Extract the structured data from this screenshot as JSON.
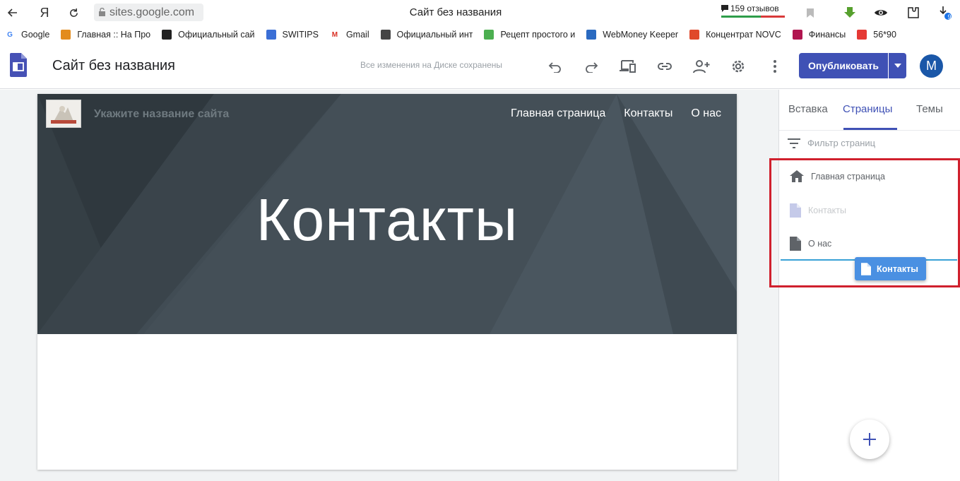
{
  "browser": {
    "url": "sites.google.com",
    "tab_title": "Сайт без названия",
    "reviews": "159 отзывов",
    "badge_count": "9"
  },
  "bookmarks": [
    {
      "label": "Google",
      "icon": "google-icon",
      "color": "#4285f4"
    },
    {
      "label": "Главная :: На Про",
      "icon": "bookmark-icon",
      "color": "#e38c1d"
    },
    {
      "label": "Официальный сай",
      "icon": "bookmark-icon",
      "color": "#222222"
    },
    {
      "label": "SWITIPS",
      "icon": "bookmark-icon",
      "color": "#3b6fd6"
    },
    {
      "label": "Gmail",
      "icon": "gmail-icon",
      "color": "#d93025"
    },
    {
      "label": "Официальный инт",
      "icon": "bookmark-icon",
      "color": "#444444"
    },
    {
      "label": "Рецепт простого и",
      "icon": "bookmark-icon",
      "color": "#4caf50"
    },
    {
      "label": "WebMoney Keeper",
      "icon": "bookmark-icon",
      "color": "#2a6ac0"
    },
    {
      "label": "Концентрат NOVC",
      "icon": "bookmark-icon",
      "color": "#e0492b"
    },
    {
      "label": "Финансы",
      "icon": "bookmark-icon",
      "color": "#b0154f"
    },
    {
      "label": "56*90",
      "icon": "bookmark-icon",
      "color": "#e53935"
    }
  ],
  "header": {
    "title": "Сайт без названия",
    "saved_status": "Все изменения на Диске сохранены",
    "publish_label": "Опубликовать",
    "avatar_letter": "M"
  },
  "site": {
    "name_placeholder": "Укажите название сайта",
    "nav": [
      "Главная страница",
      "Контакты",
      "О нас"
    ],
    "hero_title": "Контакты"
  },
  "panel": {
    "tabs": [
      "Вставка",
      "Страницы",
      "Темы"
    ],
    "filter_placeholder": "Фильтр страниц",
    "pages": [
      {
        "label": "Главная страница",
        "icon": "home-icon"
      },
      {
        "label": "Контакты",
        "icon": "page-icon"
      },
      {
        "label": "О нас",
        "icon": "page-icon"
      }
    ],
    "drag_label": "Контакты"
  },
  "colors": {
    "accent": "#3f51b5",
    "highlight_border": "#d0202d",
    "drop_indicator": "#39a2d6",
    "hero_bg": "#3c474f"
  }
}
